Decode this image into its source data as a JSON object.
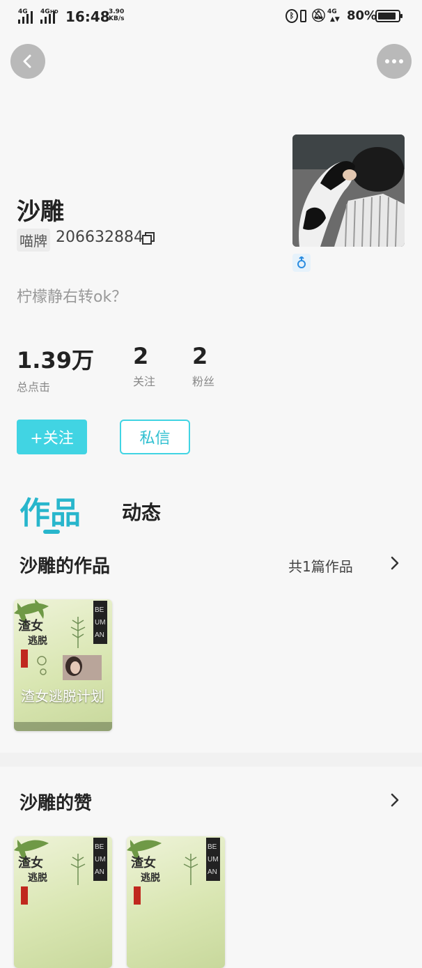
{
  "status_bar": {
    "net1": "4G",
    "net2": "4G",
    "net2_sup": "HD",
    "time": "16:48",
    "speed_value": "3.90",
    "speed_unit": "KB/s",
    "net3": "4G",
    "battery": "80%"
  },
  "profile": {
    "name": "沙雕",
    "tag": "喵牌",
    "id": "206632884",
    "bio": "柠檬静右转ok？"
  },
  "stats": [
    {
      "value": "1.39万",
      "label": "总点击"
    },
    {
      "value": "2",
      "label": "关注"
    },
    {
      "value": "2",
      "label": "粉丝"
    }
  ],
  "actions": {
    "follow": "+关注",
    "message": "私信"
  },
  "tabs": {
    "works": "作品",
    "dynamics": "动态"
  },
  "works_section": {
    "title": "沙雕的作品",
    "count": "共1篇作品",
    "items": [
      {
        "title": "渣女逃脱计划"
      }
    ]
  },
  "likes_section": {
    "title": "沙雕的赞"
  },
  "colors": {
    "accent": "#41d4e3",
    "accent_text": "#28b6cc"
  }
}
